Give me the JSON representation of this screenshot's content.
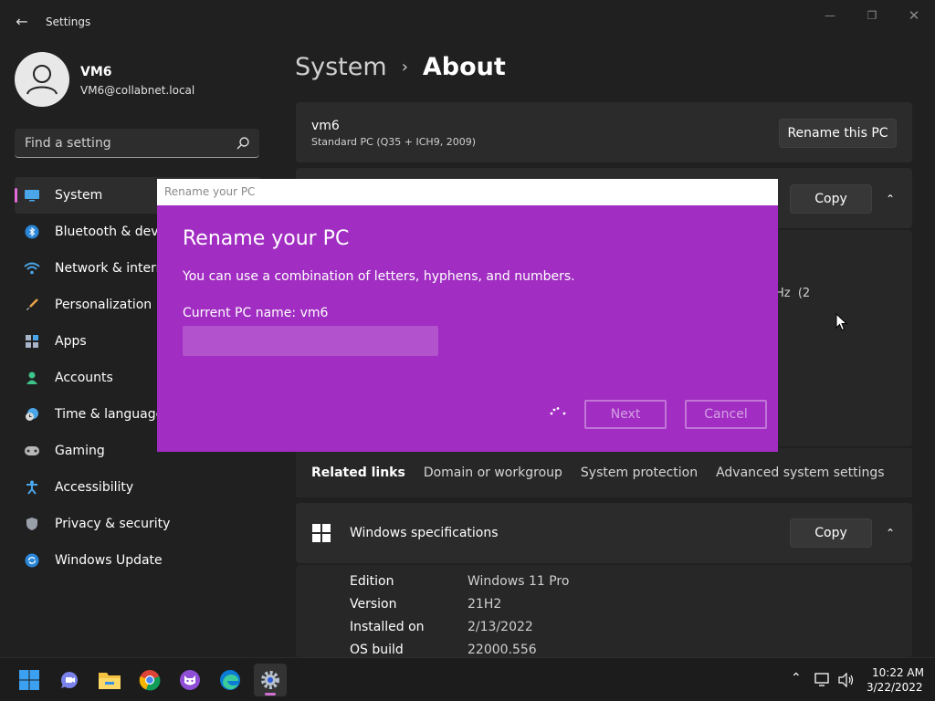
{
  "window": {
    "title": "Settings"
  },
  "user": {
    "name": "VM6",
    "email": "VM6@collabnet.local"
  },
  "search": {
    "placeholder": "Find a setting"
  },
  "sidebar": {
    "items": [
      {
        "label": "System",
        "icon": "monitor-icon",
        "selected": true
      },
      {
        "label": "Bluetooth & devices",
        "icon": "bluetooth-icon"
      },
      {
        "label": "Network & internet",
        "icon": "wifi-icon"
      },
      {
        "label": "Personalization",
        "icon": "brush-icon"
      },
      {
        "label": "Apps",
        "icon": "apps-icon"
      },
      {
        "label": "Accounts",
        "icon": "person-icon"
      },
      {
        "label": "Time & language",
        "icon": "clock-globe-icon"
      },
      {
        "label": "Gaming",
        "icon": "gamepad-icon"
      },
      {
        "label": "Accessibility",
        "icon": "accessibility-icon"
      },
      {
        "label": "Privacy & security",
        "icon": "shield-icon"
      },
      {
        "label": "Windows Update",
        "icon": "update-icon"
      }
    ]
  },
  "breadcrumb": {
    "parent": "System",
    "separator": "›",
    "current": "About"
  },
  "pc_card": {
    "name": "vm6",
    "model": "Standard PC (Q35 + ICH9, 2009)",
    "rename_button": "Rename this PC"
  },
  "device_specs": {
    "copy_button": "Copy",
    "partial_text": "Hz  (2"
  },
  "related_links": {
    "title": "Related links",
    "links": [
      "Domain or workgroup",
      "System protection",
      "Advanced system settings"
    ]
  },
  "windows_specs": {
    "title": "Windows specifications",
    "copy_button": "Copy",
    "rows": [
      {
        "label": "Edition",
        "value": "Windows 11 Pro"
      },
      {
        "label": "Version",
        "value": "21H2"
      },
      {
        "label": "Installed on",
        "value": "2/13/2022"
      },
      {
        "label": "OS build",
        "value": "22000.556"
      }
    ]
  },
  "dialog": {
    "window_title": "Rename your PC",
    "heading": "Rename your PC",
    "description": "You can use a combination of letters, hyphens, and numbers.",
    "current_name": "Current PC name: vm6",
    "input_value": "",
    "next_button": "Next",
    "cancel_button": "Cancel"
  },
  "taskbar": {
    "apps": [
      "start-icon",
      "teams-chat-icon",
      "file-explorer-icon",
      "chrome-icon",
      "app-icon",
      "edge-icon",
      "settings-icon"
    ],
    "time": "10:22 AM",
    "date": "3/22/2022"
  },
  "colors": {
    "accent": "#a12dc2",
    "selection_marker": "#e26ad9",
    "background": "#202020",
    "card": "#2b2b2b"
  }
}
